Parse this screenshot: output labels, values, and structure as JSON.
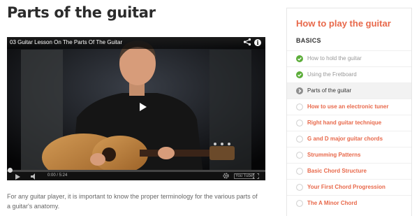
{
  "page": {
    "title": "Parts of the guitar",
    "description": "For any guitar player, it is important to know the proper terminology for the various parts of a guitar's anatomy."
  },
  "video": {
    "title": "03 Guitar Lesson On The Parts Of The Guitar",
    "time": "0:00 / 5:24",
    "progress_fraction": 0,
    "logo_text": "You Tube",
    "icons": {
      "share": "share-icon",
      "info": "info-icon",
      "play": "play-icon",
      "volume": "volume-icon",
      "settings": "gear-icon",
      "fullscreen": "fullscreen-icon"
    },
    "info_glyph": "i"
  },
  "sidebar": {
    "title": "How to play the guitar",
    "section": "BASICS",
    "accent_color": "#e8684a",
    "done_color": "#5cad3a",
    "lessons": [
      {
        "label": "How to hold the guitar",
        "status": "completed"
      },
      {
        "label": "Using the Fretboard",
        "status": "completed"
      },
      {
        "label": "Parts of the guitar",
        "status": "current"
      },
      {
        "label": "How to use an electronic tuner",
        "status": "pending"
      },
      {
        "label": "Right hand guitar technique",
        "status": "pending"
      },
      {
        "label": "G and D major guitar chords",
        "status": "pending"
      },
      {
        "label": "Strumming Patterns",
        "status": "pending"
      },
      {
        "label": "Basic Chord Structure",
        "status": "pending"
      },
      {
        "label": "Your First Chord Progression",
        "status": "pending"
      },
      {
        "label": "The A Minor Chord",
        "status": "pending"
      }
    ]
  }
}
